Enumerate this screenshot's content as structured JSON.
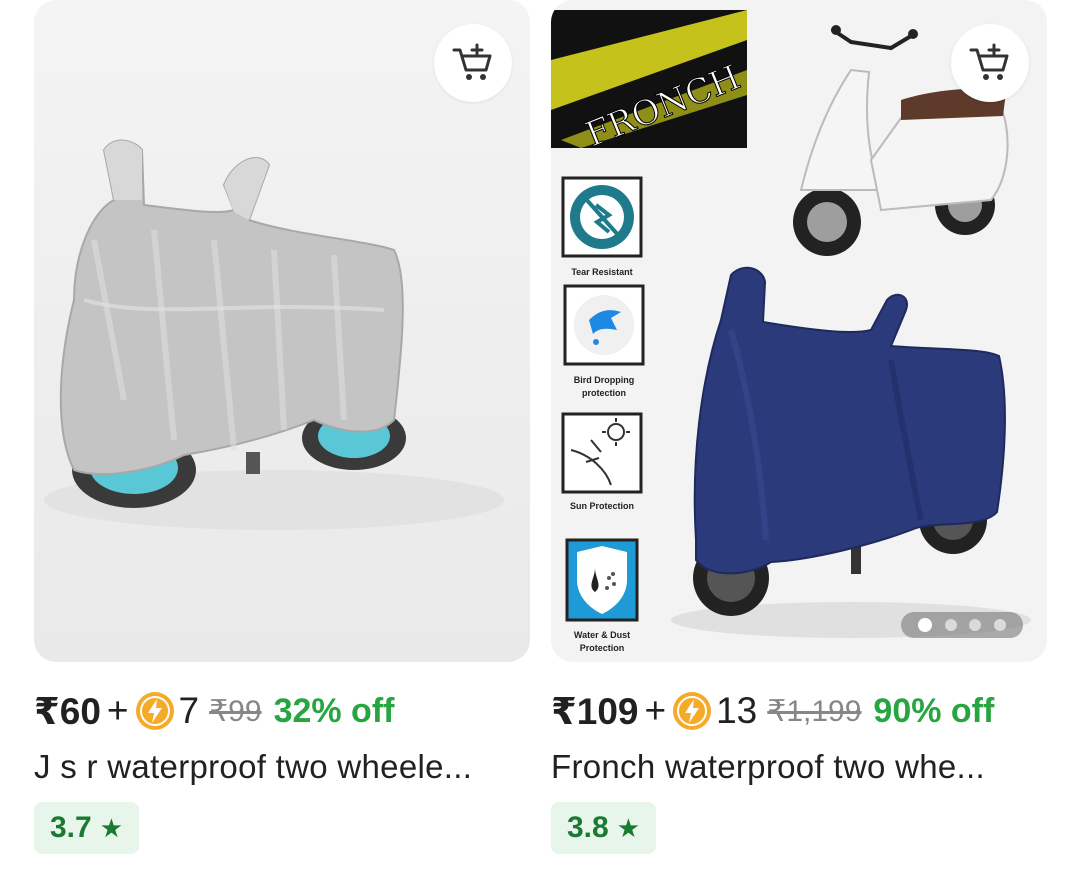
{
  "products": [
    {
      "price": "₹60",
      "plus": "+",
      "coins": "7",
      "mrp": "₹99",
      "discount": "32% off",
      "title": "J s r waterproof two wheele...",
      "rating": "3.7",
      "cover_color": "#bdbdbd"
    },
    {
      "price": "₹109",
      "plus": "+",
      "coins": "13",
      "mrp": "₹1,199",
      "discount": "90% off",
      "title": "Fronch waterproof two whe...",
      "rating": "3.8",
      "cover_color": "#2b3a7a",
      "brand_logo": "FRONCH",
      "features": [
        {
          "label_line1": "Tear Resistant",
          "label_line2": ""
        },
        {
          "label_line1": "Bird Dropping",
          "label_line2": "protection"
        },
        {
          "label_line1": "Sun Protection",
          "label_line2": ""
        },
        {
          "label_line1": "Water & Dust",
          "label_line2": "Protection"
        }
      ],
      "carousel": {
        "count": 4,
        "active": 1
      }
    }
  ],
  "icons": {
    "cart": "add-to-cart-icon",
    "coin": "supercoin-icon",
    "star": "star-icon"
  },
  "colors": {
    "discount": "#26a541",
    "rating_bg": "#e8f5ea",
    "rating_text": "#1b7a31",
    "coin": "#f7a928"
  }
}
